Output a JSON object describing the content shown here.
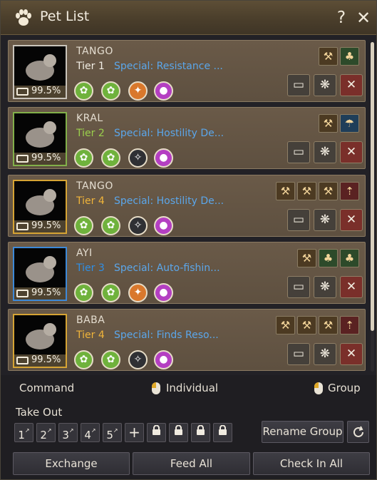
{
  "window": {
    "title": "Pet List",
    "help_glyph": "?",
    "close_glyph": "✕",
    "title_icon": "paw-icon"
  },
  "pets": [
    {
      "name": "TANGO",
      "tier": "Tier 1",
      "tier_level": 1,
      "special": "Special: Resistance ...",
      "hunger": "99.5%",
      "skills": [
        "green",
        "green",
        "orange",
        "purple"
      ],
      "talents": [
        "a",
        "b"
      ]
    },
    {
      "name": "KRAL",
      "tier": "Tier 2",
      "tier_level": 2,
      "special": "Special: Hostility De...",
      "hunger": "99.5%",
      "skills": [
        "green",
        "green",
        "gray",
        "purple"
      ],
      "talents": [
        "a",
        "c"
      ]
    },
    {
      "name": "TANGO",
      "tier": "Tier 4",
      "tier_level": 4,
      "special": "Special: Hostility De...",
      "hunger": "99.5%",
      "skills": [
        "green",
        "green",
        "gray",
        "purple"
      ],
      "talents": [
        "a",
        "a",
        "a",
        "d"
      ]
    },
    {
      "name": "AYI",
      "tier": "Tier 3",
      "tier_level": 3,
      "special": "Special: Auto-fishin...",
      "hunger": "99.5%",
      "skills": [
        "green",
        "green",
        "orange",
        "purple"
      ],
      "talents": [
        "a",
        "b",
        "b"
      ]
    },
    {
      "name": "BABA",
      "tier": "Tier 4",
      "tier_level": 4,
      "special": "Special: Finds Reso...",
      "hunger": "99.5%",
      "skills": [
        "green",
        "green",
        "gray",
        "purple"
      ],
      "talents": [
        "a",
        "a",
        "a",
        "d"
      ]
    }
  ],
  "commands": {
    "label": "Command",
    "individual": "Individual",
    "group": "Group"
  },
  "take_out": {
    "label": "Take Out",
    "slots": [
      "1",
      "2",
      "3",
      "4",
      "5"
    ],
    "add_glyph": "+",
    "locked_count": 4,
    "rename_group": "Rename Group"
  },
  "footer": {
    "exchange": "Exchange",
    "feed_all": "Feed All",
    "check_in_all": "Check In All"
  },
  "colors": {
    "tier2": "#9bd04c",
    "tier3": "#2f8fe6",
    "tier4": "#f0b43a",
    "special": "#5ba6ea"
  }
}
